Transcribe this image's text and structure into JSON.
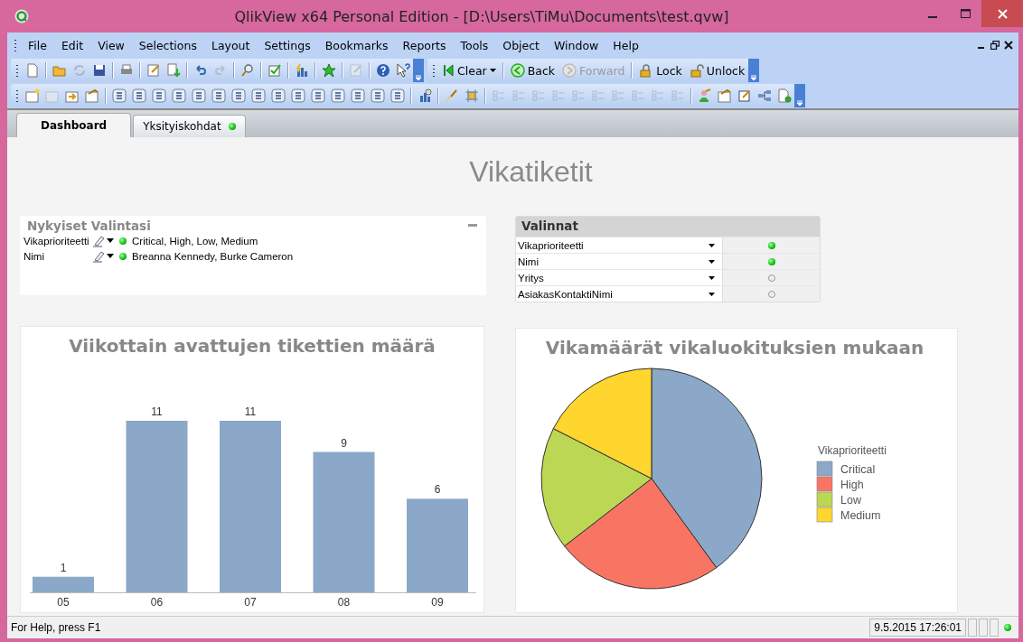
{
  "window": {
    "title": "QlikView x64 Personal Edition - [D:\\Users\\TiMu\\Documents\\test.qvw]"
  },
  "menu": [
    "File",
    "Edit",
    "View",
    "Selections",
    "Layout",
    "Settings",
    "Bookmarks",
    "Reports",
    "Tools",
    "Object",
    "Window",
    "Help"
  ],
  "toolbar_buttons": [
    {
      "label": "Clear",
      "kind": "clear",
      "disabled": false
    },
    {
      "label": "Back",
      "kind": "back",
      "disabled": false
    },
    {
      "label": "Forward",
      "kind": "forward",
      "disabled": true
    },
    {
      "label": "Lock",
      "kind": "lock",
      "disabled": false
    },
    {
      "label": "Unlock",
      "kind": "unlock",
      "disabled": false
    }
  ],
  "tabs": [
    {
      "label": "Dashboard",
      "selected": true,
      "has_selections": false
    },
    {
      "label": "Yksityiskohdat",
      "selected": false,
      "has_selections": true
    }
  ],
  "sheet": {
    "title": "Vikatiketit"
  },
  "current_selections": {
    "title": "Nykyiset Valintasi",
    "rows": [
      {
        "field": "Vikaprioriteetti",
        "values": "Critical, High, Low, Medium"
      },
      {
        "field": "Nimi",
        "values": "Breanna Kennedy, Burke Cameron"
      }
    ]
  },
  "multibox": {
    "title": "Valinnat",
    "rows": [
      {
        "field": "Vikaprioriteetti",
        "active": true
      },
      {
        "field": "Nimi",
        "active": true
      },
      {
        "field": "Yritys",
        "active": false
      },
      {
        "field": "AsiakasKontaktiNimi",
        "active": false
      }
    ]
  },
  "bar_chart": {
    "chart_data": {
      "type": "bar",
      "title": "Viikottain avattujen tikettien määrä",
      "categories": [
        "05",
        "06",
        "07",
        "08",
        "09"
      ],
      "values": [
        1,
        11,
        11,
        9,
        6
      ],
      "data_labels": true,
      "color": "#8ba8c8"
    }
  },
  "pie_chart": {
    "title": "Vikamäärät vikaluokituksien mukaan",
    "legend_title": "Vikaprioriteetti",
    "legend": [
      {
        "label": "Critical",
        "color": "#8ba8c8"
      },
      {
        "label": "High",
        "color": "#f87563"
      },
      {
        "label": "Low",
        "color": "#bcd753"
      },
      {
        "label": "Medium",
        "color": "#fed62e"
      }
    ]
  },
  "status_bar": {
    "help": "For Help, press F1",
    "timestamp": "9.5.2015 17:26:01"
  }
}
